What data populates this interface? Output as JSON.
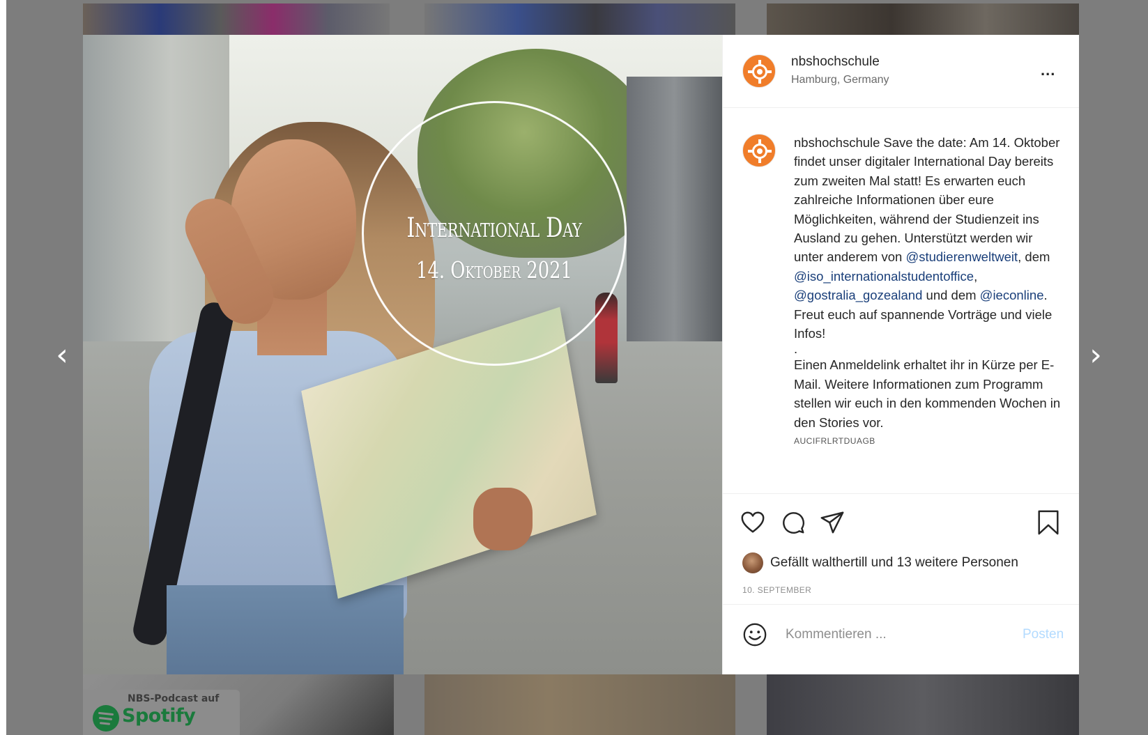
{
  "nav": {
    "prev_icon": "chevron-left-icon",
    "next_icon": "chevron-right-icon",
    "prev_glyph": "‹",
    "next_glyph": "›"
  },
  "background_tiles": {
    "podcast_small": "NBS-Podcast auf",
    "podcast_brand": "Spotify"
  },
  "post": {
    "image": {
      "event_title": "International Day",
      "event_date": "14. Oktober 2021"
    },
    "header": {
      "username": "nbshochschule",
      "location": "Hamburg, Germany",
      "more_label": "..."
    },
    "caption": {
      "username": "nbshochschule",
      "text_1": "Save the date: Am 14. Oktober findet unser digitaler International Day bereits zum zweiten Mal statt! Es erwarten euch zahlreiche Informationen über eure Möglichkeiten, während der Studienzeit ins Ausland zu gehen. Unterstützt werden wir unter anderem von",
      "mention_1": "@studierenweltweit",
      "text_2": ", dem",
      "mention_2": "@iso_internationalstudentoffice",
      "text_3": ",",
      "mention_3": "@gostralia_gozealand",
      "text_4": "und dem",
      "mention_4": "@ieconline",
      "text_5": ". Freut euch auf spannende Vorträge und viele Infos!",
      "dot_line": ".",
      "paragraph_2": "Einen Anmeldelink erhaltet ihr in Kürze per E-Mail. Weitere Informationen zum Programm stellen wir euch in den kommenden Wochen in den Stories vor.",
      "code_line": "AUCIFRLRTDUAGB"
    },
    "actions": {
      "like_icon": "heart-icon",
      "comment_icon": "comment-icon",
      "share_icon": "send-icon",
      "save_icon": "bookmark-icon"
    },
    "likes_text": "Gefällt walthertill und 13 weitere Personen",
    "date": "10. SEPTEMBER",
    "comment": {
      "placeholder": "Kommentieren ...",
      "post_label": "Posten",
      "emoji_icon": "smiley-icon"
    }
  },
  "colors": {
    "brand_orange": "#f07d2a",
    "overlay_gray": "#7d7d7d",
    "mention_blue": "#1a3f7a",
    "post_button_disabled": "#b3dbff"
  }
}
